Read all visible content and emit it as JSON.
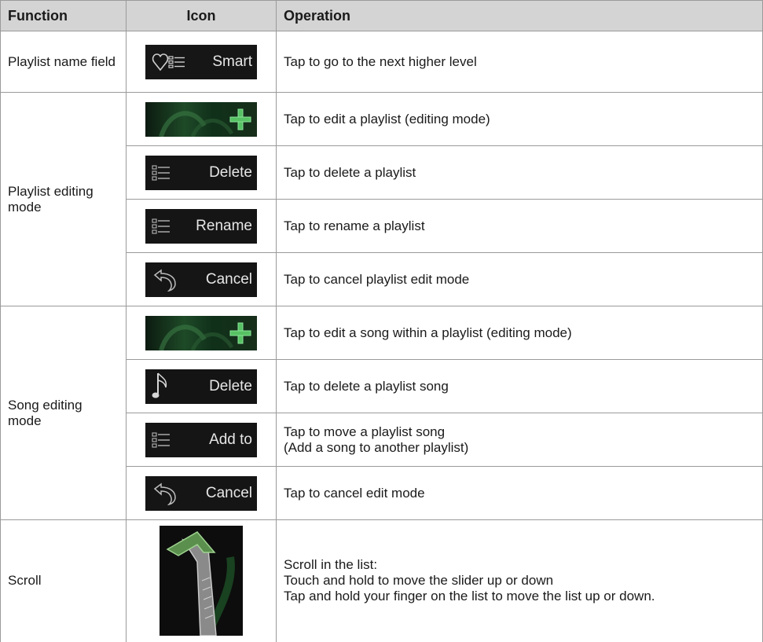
{
  "headers": {
    "function": "Function",
    "icon": "Icon",
    "operation": "Operation"
  },
  "rows": {
    "playlist_name": {
      "function": "Playlist name field",
      "icon_label": "Smart",
      "icon_name": "heart-list-icon",
      "operation": "Tap to go to the next higher level"
    },
    "playlist_editing": {
      "function": "Playlist editing mode",
      "items": [
        {
          "icon_label": "",
          "icon_name": "plus-icon",
          "operation": "Tap to edit a playlist (editing mode)"
        },
        {
          "icon_label": "Delete",
          "icon_name": "list-icon",
          "operation": "Tap to delete a playlist"
        },
        {
          "icon_label": "Rename",
          "icon_name": "list-icon",
          "operation": "Tap to rename a playlist"
        },
        {
          "icon_label": "Cancel",
          "icon_name": "back-arrow-icon",
          "operation": "Tap to cancel playlist edit mode"
        }
      ]
    },
    "song_editing": {
      "function": "Song editing mode",
      "items": [
        {
          "icon_label": "",
          "icon_name": "plus-icon",
          "operation": "Tap to edit a song within a playlist (editing mode)"
        },
        {
          "icon_label": "Delete",
          "icon_name": "music-note-icon",
          "operation": "Tap to delete a playlist song"
        },
        {
          "icon_label": "Add to",
          "icon_name": "list-icon",
          "operation_lines": [
            "Tap to move a playlist song",
            "(Add a song to another playlist)"
          ]
        },
        {
          "icon_label": "Cancel",
          "icon_name": "back-arrow-icon",
          "operation": "Tap to cancel edit mode"
        }
      ]
    },
    "scroll": {
      "function": "Scroll",
      "icon_name": "scroll-slider-icon",
      "operation_lines": [
        "Scroll in the list:",
        "Touch and hold to move the slider up or down",
        "Tap and hold your finger on the list to move the list up or down."
      ]
    }
  },
  "colors": {
    "header_bg": "#d4d4d4",
    "border": "#9a9a9a",
    "button_bg": "#151515",
    "accent_green": "#3fae4f"
  }
}
